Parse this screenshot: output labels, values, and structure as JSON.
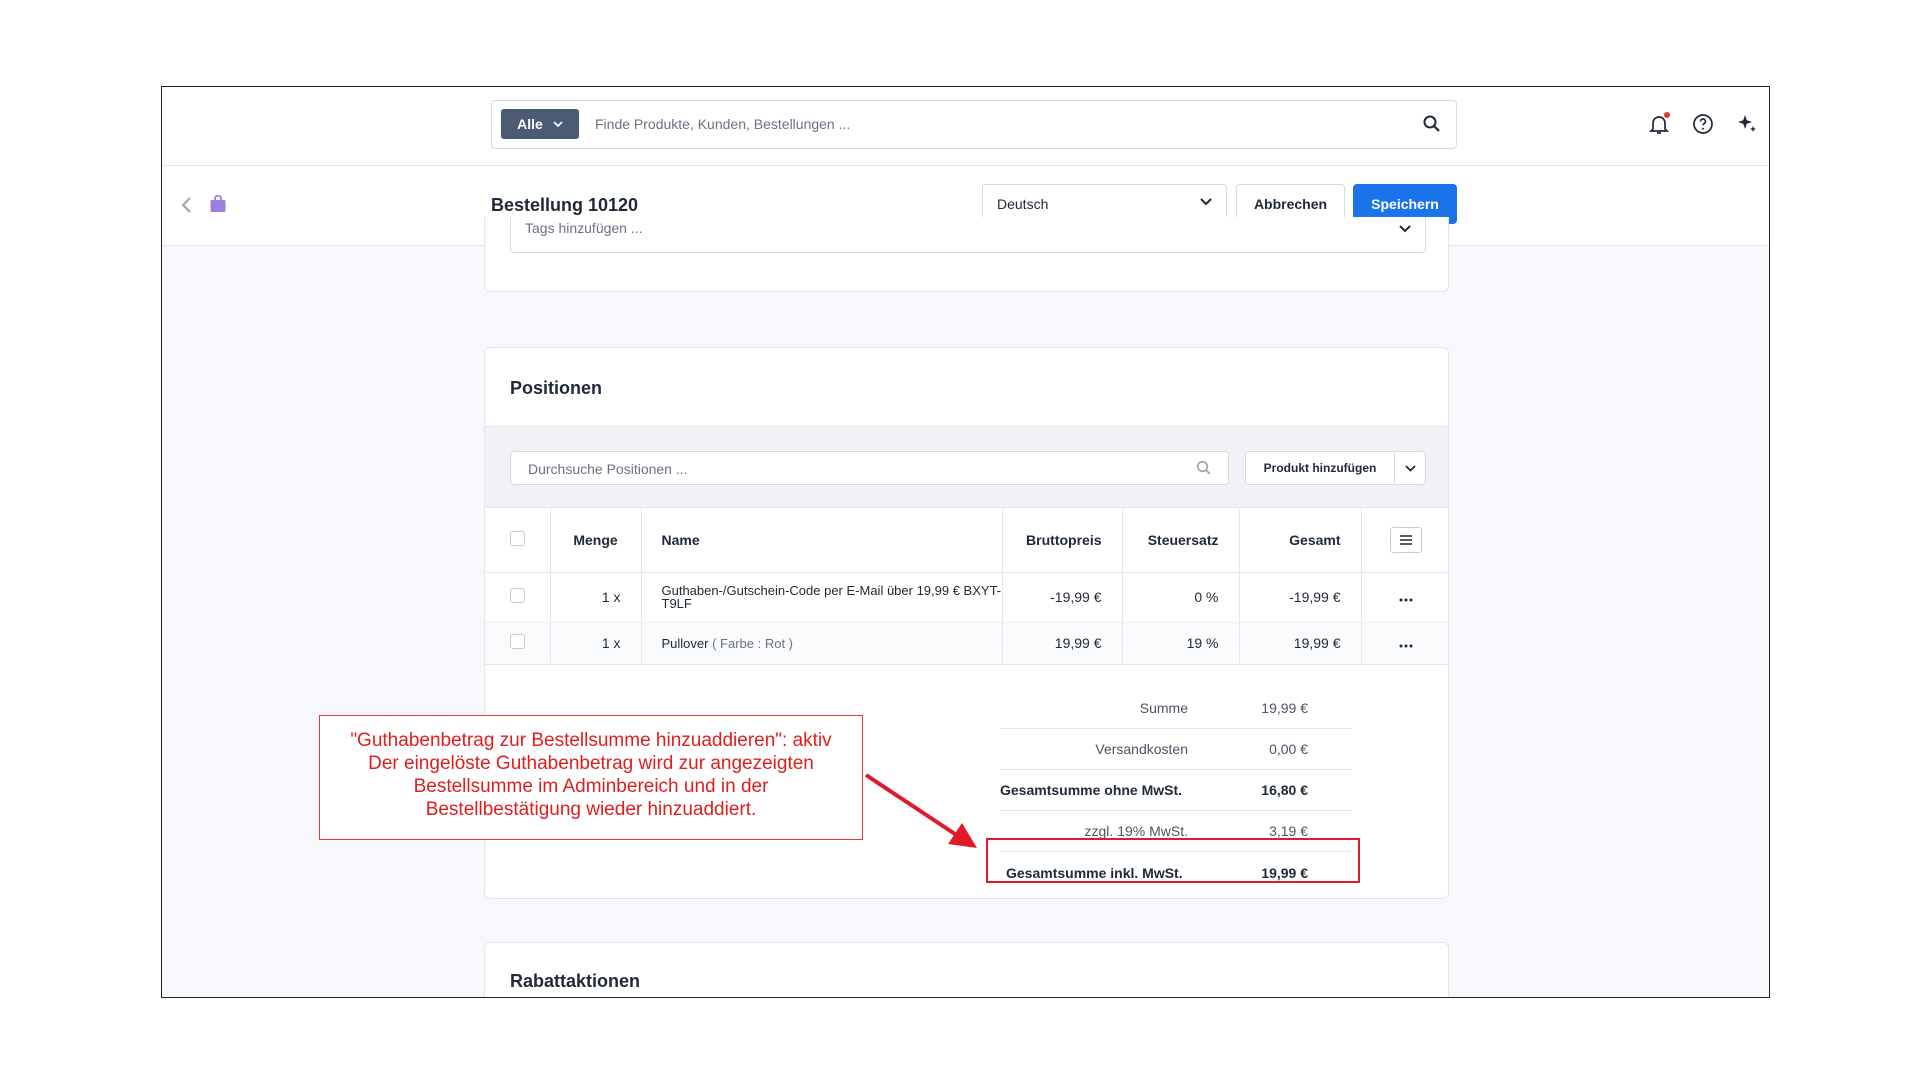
{
  "topbar": {
    "search_filter": "Alle",
    "search_placeholder": "Finde Produkte, Kunden, Bestellungen ..."
  },
  "header": {
    "title": "Bestellung 10120",
    "language": "Deutsch",
    "cancel_label": "Abbrechen",
    "save_label": "Speichern"
  },
  "tags": {
    "placeholder": "Tags hinzufügen ..."
  },
  "positions": {
    "title": "Positionen",
    "search_placeholder": "Durchsuche Positionen ...",
    "add_product_label": "Produkt hinzufügen",
    "columns": [
      "Menge",
      "Name",
      "Bruttopreis",
      "Steuersatz",
      "Gesamt"
    ],
    "rows": [
      {
        "qty": "1 x",
        "name": "Guthaben-/Gutschein-Code per E-Mail über 19,99 € BXYT-T9LF",
        "variant": "",
        "price": "-19,99 €",
        "tax": "0 %",
        "total": "-19,99 €"
      },
      {
        "qty": "1 x",
        "name": "Pullover",
        "variant": "( Farbe : Rot )",
        "price": "19,99 €",
        "tax": "19 %",
        "total": "19,99 €"
      }
    ]
  },
  "summary": [
    {
      "label": "Summe",
      "value": "19,99 €"
    },
    {
      "label": "Versandkosten",
      "value": "0,00 €"
    },
    {
      "label": "Gesamtsumme ohne MwSt.",
      "value": "16,80 €"
    },
    {
      "label": "zzgl. 19% MwSt.",
      "value": "3,19 €"
    },
    {
      "label": "Gesamtsumme inkl. MwSt.",
      "value": "19,99 €"
    }
  ],
  "discounts": {
    "title": "Rabattaktionen"
  },
  "annotation": {
    "line1": "\"Guthabenbetrag zur Bestellsumme hinzuaddieren\": aktiv",
    "line2": "Der eingelöste Guthabenbetrag wird zur angezeigten",
    "line3": "Bestellsumme im Adminbereich und in der",
    "line4": "Bestellbestätigung wieder hinzuaddiert."
  },
  "colors": {
    "primary": "#1a73e8",
    "annotation": "#e01e1e",
    "filter_bg": "#4b5b74",
    "bag": "#9b7fe0"
  },
  "icons": [
    "search-icon",
    "bell-icon",
    "help-icon",
    "sparkle-icon",
    "chevron-left-icon",
    "bag-icon",
    "chevron-down-icon",
    "hamburger-icon",
    "more-icon"
  ]
}
